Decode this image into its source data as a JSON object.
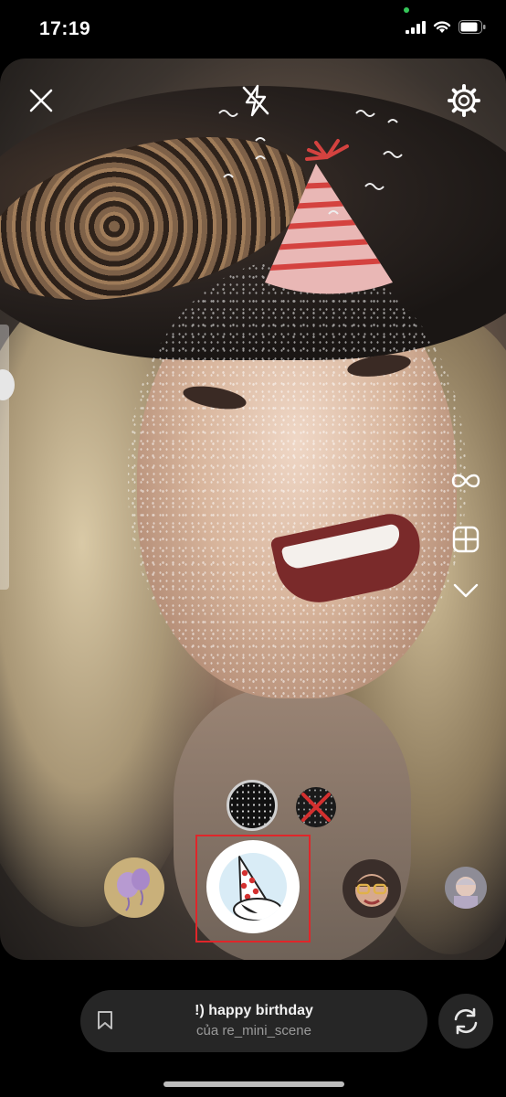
{
  "status_bar": {
    "time": "17:19",
    "signal_icon": "cellular-signal-icon",
    "wifi_icon": "wifi-icon",
    "battery_icon": "battery-icon"
  },
  "camera": {
    "close_icon": "close-icon",
    "flash_icon": "flash-off-icon",
    "settings_icon": "settings-gear-icon",
    "right_tools": [
      "infinity-boomerang-icon",
      "layout-grid-icon",
      "chevron-down-icon"
    ]
  },
  "effect_variants": [
    "glitter-variant",
    "no-effect-variant"
  ],
  "effects_tray": [
    "balloons-effect",
    "party-hat-effect",
    "face-filter-effect",
    "kid-filter-effect"
  ],
  "effect_info": {
    "title": "!) happy birthday",
    "subtitle": "của re_mini_scene",
    "bookmark_icon": "bookmark-icon"
  },
  "flip_camera_icon": "flip-camera-icon",
  "colors": {
    "selection": "#e0262a",
    "hat_red": "#d4423f",
    "hat_pink": "#e9b7b5"
  }
}
